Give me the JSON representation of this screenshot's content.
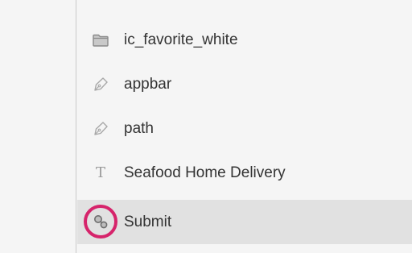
{
  "layers": [
    {
      "label": "ic_favorite_white",
      "icon": "folder-icon",
      "selected": false
    },
    {
      "label": "appbar",
      "icon": "pen-icon",
      "selected": false
    },
    {
      "label": "path",
      "icon": "pen-icon",
      "selected": false
    },
    {
      "label": "Seafood Home Delivery",
      "icon": "text-icon",
      "selected": false
    },
    {
      "label": "Submit",
      "icon": "symbol-link-icon",
      "selected": true
    }
  ],
  "text_icon_glyph": "T",
  "colors": {
    "background": "#f5f5f5",
    "selected_row": "#e1e1e1",
    "highlight_ring": "#d6246b",
    "icon_gray": "#9a9a9a",
    "label_text": "#333333"
  }
}
